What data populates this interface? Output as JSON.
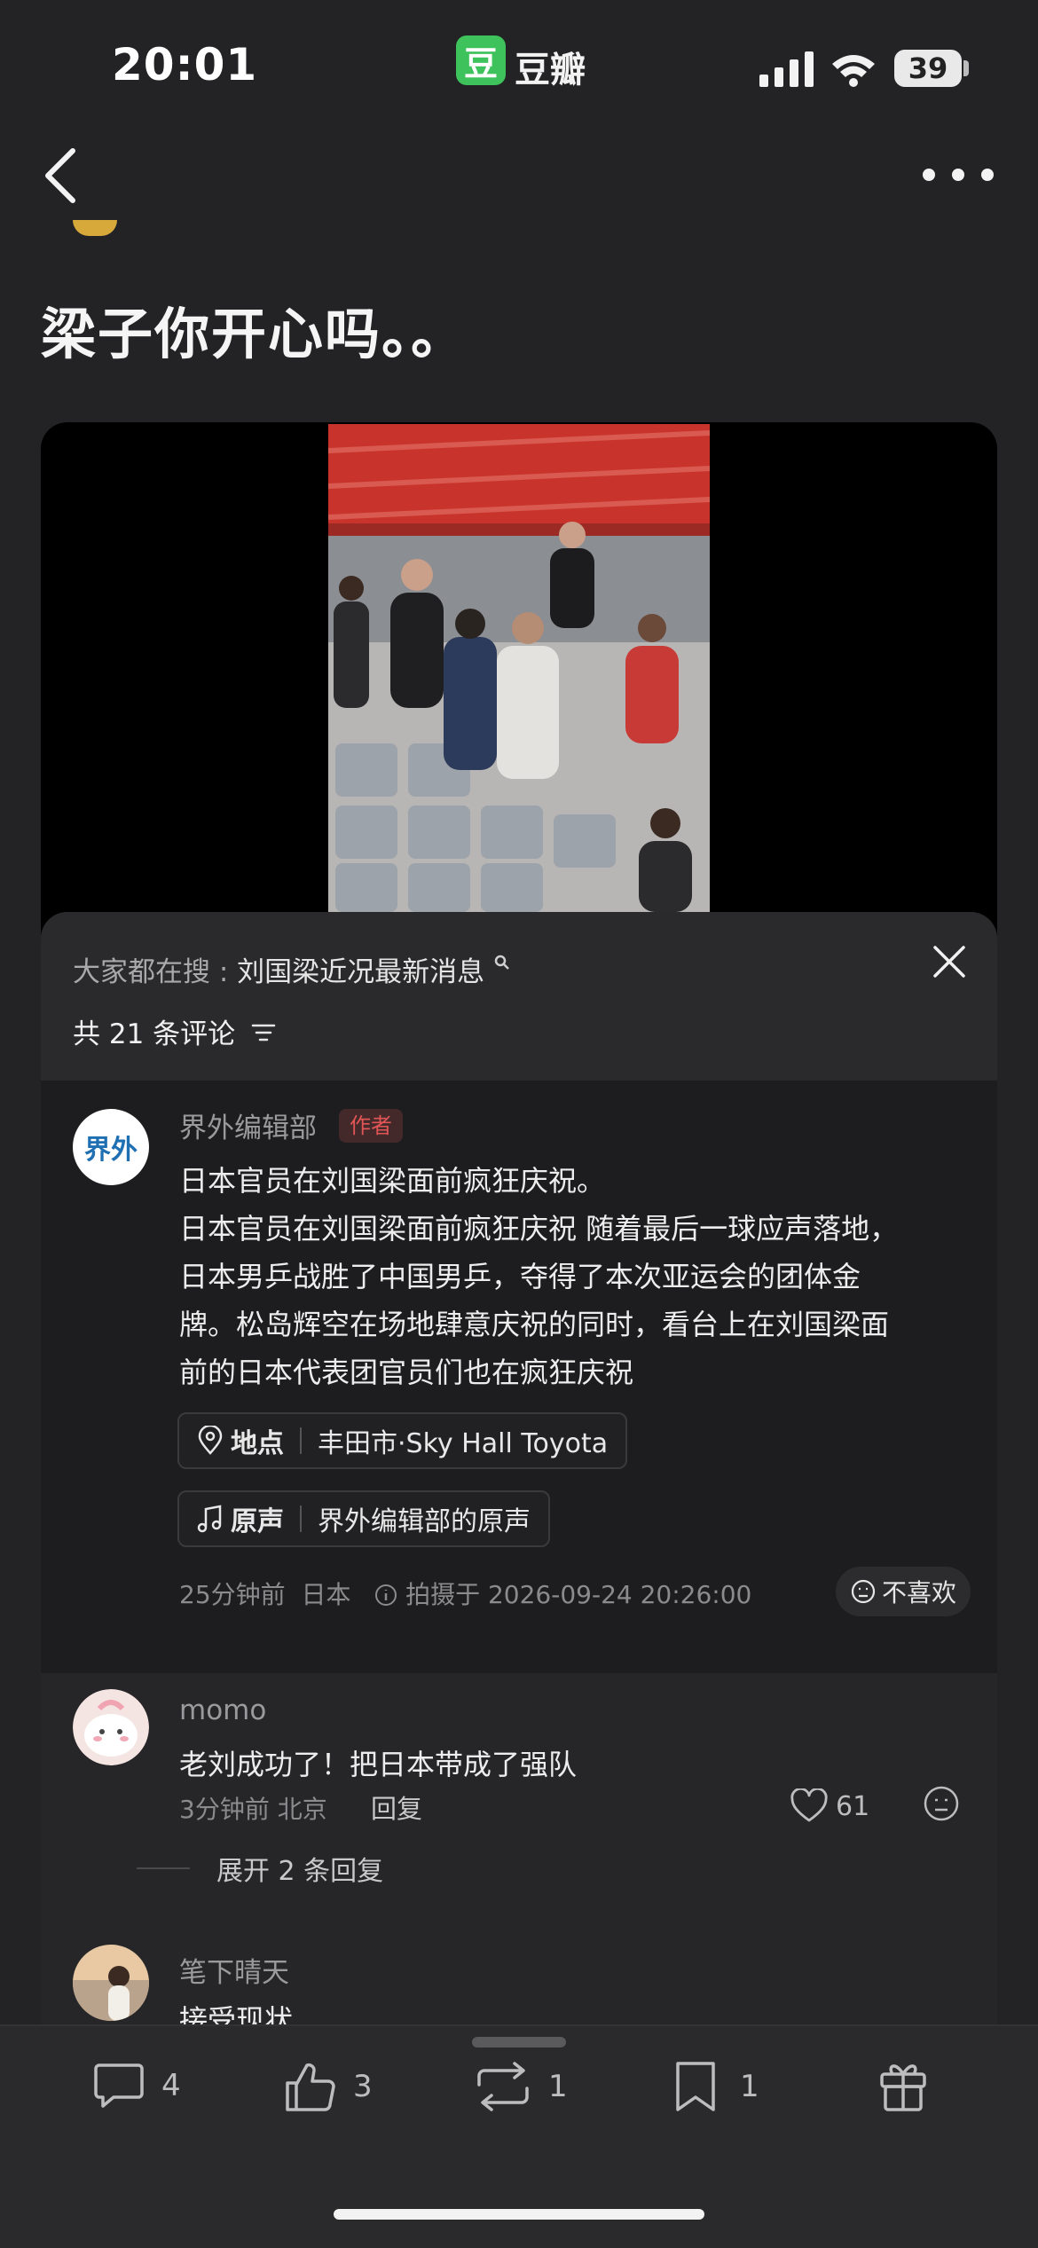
{
  "status_bar": {
    "time": "20:01",
    "app_badge": "豆",
    "app_name": "豆瓣",
    "battery": "39"
  },
  "post": {
    "title": "梁子你开心吗。。"
  },
  "sheet": {
    "search_prefix": "大家都在搜 : ",
    "search_keyword": "刘国梁近况最新消息",
    "comment_count": "共 21 条评论"
  },
  "author_post": {
    "avatar_text": "界外",
    "name": "界外编辑部",
    "tag": "作者",
    "lines": [
      "日本官员在刘国梁面前疯狂庆祝。",
      "日本官员在刘国梁面前疯狂庆祝  随着最后一球应声落地，",
      "日本男乒战胜了中国男乒，夺得了本次亚运会的团体金",
      "牌。松岛辉空在场地肆意庆祝的同时，看台上在刘国梁面",
      "前的日本代表团官员们也在疯狂庆祝"
    ],
    "location_key": "地点",
    "location_value": "丰田市·Sky Hall Toyota",
    "music_key": "原声",
    "music_value": "界外编辑部的原声",
    "meta_time": "25分钟前",
    "meta_region": "日本",
    "meta_shot": "拍摄于 2026-09-24 20:26:00",
    "dislike": "不喜欢"
  },
  "comments": [
    {
      "name": "momo",
      "text": "老刘成功了！把日本带成了强队",
      "time": "3分钟前",
      "region": "北京",
      "reply": "回复",
      "likes": "61",
      "expand": "展开 2 条回复"
    },
    {
      "name": "笔下晴天",
      "text": "接受现状"
    }
  ],
  "bottom_bar": {
    "comments": "4",
    "likes": "3",
    "reposts": "1",
    "saves": "1"
  }
}
